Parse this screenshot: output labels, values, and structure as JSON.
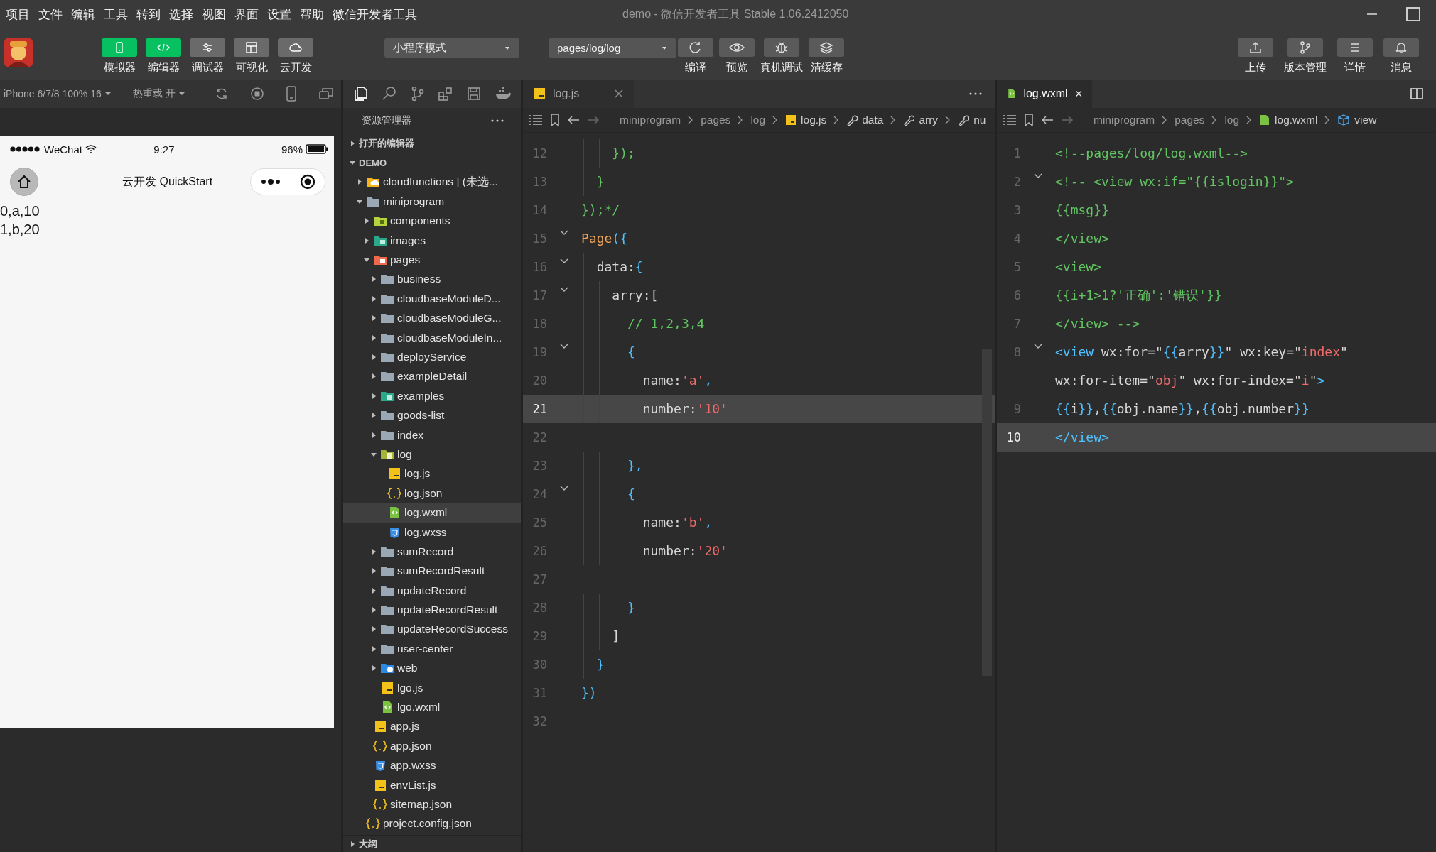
{
  "menu": [
    "项目",
    "文件",
    "编辑",
    "工具",
    "转到",
    "选择",
    "视图",
    "界面",
    "设置",
    "帮助",
    "微信开发者工具"
  ],
  "window": {
    "title": "demo - 微信开发者工具 Stable 1.06.2412050"
  },
  "view_toggles": [
    {
      "label": "模拟器",
      "kind": "phone",
      "on": true
    },
    {
      "label": "编辑器",
      "kind": "code",
      "on": true
    },
    {
      "label": "调试器",
      "kind": "debug",
      "on": false
    },
    {
      "label": "可视化",
      "kind": "layout",
      "on": false
    },
    {
      "label": "云开发",
      "kind": "cloud",
      "on": false
    }
  ],
  "mode_select": {
    "value": "小程序模式"
  },
  "page_select": {
    "value": "pages/log/log"
  },
  "actions": [
    {
      "label": "编译",
      "kind": "refresh"
    },
    {
      "label": "预览",
      "kind": "eye"
    },
    {
      "label": "真机调试",
      "kind": "bug"
    },
    {
      "label": "清缓存",
      "kind": "layers"
    }
  ],
  "right_actions": [
    {
      "label": "上传",
      "kind": "upload"
    },
    {
      "label": "版本管理",
      "kind": "branch"
    },
    {
      "label": "详情",
      "kind": "lines"
    },
    {
      "label": "消息",
      "kind": "bell"
    }
  ],
  "simulator": {
    "device": "iPhone 6/7/8 100% 16",
    "hot_reload": "热重载 开",
    "status": {
      "carrier": "WeChat",
      "time": "9:27",
      "battery": "96%"
    },
    "nav_title": "云开发 QuickStart",
    "lines": [
      "0,a,10",
      "1,b,20"
    ]
  },
  "explorer": {
    "title": "资源管理器",
    "tree": [
      {
        "label": "打开的编辑器",
        "kind": "section",
        "expanded": false,
        "selected": false
      },
      {
        "label": "DEMO",
        "kind": "section",
        "expanded": true,
        "selected": false,
        "children": [
          {
            "label": "cloudfunctions | (未选...",
            "kind": "folder-cloud",
            "expanded": false,
            "selected": false
          },
          {
            "label": "miniprogram",
            "kind": "folder",
            "expanded": true,
            "selected": false,
            "children": [
              {
                "label": "components",
                "kind": "folder-components",
                "expanded": false,
                "selected": false
              },
              {
                "label": "images",
                "kind": "folder-images",
                "expanded": false,
                "selected": false
              },
              {
                "label": "pages",
                "kind": "folder-pages",
                "expanded": true,
                "selected": false,
                "children": [
                  {
                    "label": "business",
                    "kind": "folder",
                    "expanded": false,
                    "selected": false
                  },
                  {
                    "label": "cloudbaseModuleD...",
                    "kind": "folder",
                    "expanded": false,
                    "selected": false
                  },
                  {
                    "label": "cloudbaseModuleG...",
                    "kind": "folder",
                    "expanded": false,
                    "selected": false
                  },
                  {
                    "label": "cloudbaseModuleIn...",
                    "kind": "folder",
                    "expanded": false,
                    "selected": false
                  },
                  {
                    "label": "deployService",
                    "kind": "folder",
                    "expanded": false,
                    "selected": false
                  },
                  {
                    "label": "exampleDetail",
                    "kind": "folder",
                    "expanded": false,
                    "selected": false
                  },
                  {
                    "label": "examples",
                    "kind": "folder-images",
                    "expanded": false,
                    "selected": false
                  },
                  {
                    "label": "goods-list",
                    "kind": "folder",
                    "expanded": false,
                    "selected": false
                  },
                  {
                    "label": "index",
                    "kind": "folder",
                    "expanded": false,
                    "selected": false
                  },
                  {
                    "label": "log",
                    "kind": "folder-log",
                    "expanded": true,
                    "selected": false,
                    "children": [
                      {
                        "label": "log.js",
                        "kind": "js",
                        "selected": false
                      },
                      {
                        "label": "log.json",
                        "kind": "json",
                        "selected": false
                      },
                      {
                        "label": "log.wxml",
                        "kind": "wxml",
                        "selected": true
                      },
                      {
                        "label": "log.wxss",
                        "kind": "wxss",
                        "selected": false
                      }
                    ]
                  },
                  {
                    "label": "sumRecord",
                    "kind": "folder",
                    "expanded": false,
                    "selected": false
                  },
                  {
                    "label": "sumRecordResult",
                    "kind": "folder",
                    "expanded": false,
                    "selected": false
                  },
                  {
                    "label": "updateRecord",
                    "kind": "folder",
                    "expanded": false,
                    "selected": false
                  },
                  {
                    "label": "updateRecordResult",
                    "kind": "folder",
                    "expanded": false,
                    "selected": false
                  },
                  {
                    "label": "updateRecordSuccess",
                    "kind": "folder",
                    "expanded": false,
                    "selected": false
                  },
                  {
                    "label": "user-center",
                    "kind": "folder",
                    "expanded": false,
                    "selected": false
                  },
                  {
                    "label": "web",
                    "kind": "folder-web",
                    "expanded": false,
                    "selected": false
                  },
                  {
                    "label": "lgo.js",
                    "kind": "js",
                    "selected": false
                  },
                  {
                    "label": "lgo.wxml",
                    "kind": "wxml",
                    "selected": false
                  }
                ]
              },
              {
                "label": "app.js",
                "kind": "js",
                "selected": false
              },
              {
                "label": "app.json",
                "kind": "json",
                "selected": false
              },
              {
                "label": "app.wxss",
                "kind": "wxss",
                "selected": false
              },
              {
                "label": "envList.js",
                "kind": "js",
                "selected": false
              },
              {
                "label": "sitemap.json",
                "kind": "json",
                "selected": false
              }
            ]
          },
          {
            "label": "project.config.json",
            "kind": "json",
            "selected": false
          }
        ]
      }
    ],
    "outline": {
      "label": "大纲",
      "expanded": false
    }
  },
  "editors": [
    {
      "tab": {
        "label": "log.js",
        "kind": "js"
      },
      "breadcrumb": [
        {
          "label": "miniprogram",
          "kind": "path"
        },
        {
          "label": "pages",
          "kind": "path"
        },
        {
          "label": "log",
          "kind": "path"
        },
        {
          "label": "log.js",
          "kind": "js"
        },
        {
          "label": "data",
          "kind": "wrench"
        },
        {
          "label": "arry",
          "kind": "wrench"
        },
        {
          "label": "nu",
          "kind": "wrench"
        }
      ],
      "lines": [
        {
          "no": "12",
          "fold": false,
          "current": false,
          "segments": [
            {
              "kind": "comment",
              "text": "    });"
            }
          ]
        },
        {
          "no": "13",
          "fold": false,
          "current": false,
          "segments": [
            {
              "kind": "comment",
              "text": "  }"
            }
          ]
        },
        {
          "no": "14",
          "fold": false,
          "current": false,
          "segments": [
            {
              "kind": "comment",
              "text": "});*/"
            }
          ]
        },
        {
          "no": "15",
          "fold": true,
          "current": false,
          "segments": [
            {
              "kind": "func",
              "text": "Page"
            },
            {
              "kind": "brace",
              "text": "({"
            }
          ]
        },
        {
          "no": "16",
          "fold": true,
          "current": false,
          "segments": [
            {
              "kind": "plain",
              "text": "  data:"
            },
            {
              "kind": "brace",
              "text": "{"
            }
          ]
        },
        {
          "no": "17",
          "fold": true,
          "current": false,
          "segments": [
            {
              "kind": "plain",
              "text": "    arry:["
            }
          ]
        },
        {
          "no": "18",
          "fold": false,
          "current": false,
          "segments": [
            {
              "kind": "comment",
              "text": "      // 1,2,3,4"
            }
          ]
        },
        {
          "no": "19",
          "fold": true,
          "current": false,
          "segments": [
            {
              "kind": "brace",
              "text": "      {"
            }
          ]
        },
        {
          "no": "20",
          "fold": false,
          "current": false,
          "segments": [
            {
              "kind": "plain",
              "text": "        name:"
            },
            {
              "kind": "string",
              "text": "'a'"
            },
            {
              "kind": "brace",
              "text": ","
            }
          ]
        },
        {
          "no": "21",
          "fold": false,
          "current": true,
          "segments": [
            {
              "kind": "plain",
              "text": "        number:"
            },
            {
              "kind": "string",
              "text": "'10'"
            }
          ]
        },
        {
          "no": "22",
          "fold": false,
          "current": false
        },
        {
          "no": "23",
          "fold": false,
          "current": false,
          "segments": [
            {
              "kind": "brace",
              "text": "      },"
            }
          ]
        },
        {
          "no": "24",
          "fold": true,
          "current": false,
          "segments": [
            {
              "kind": "brace",
              "text": "      {"
            }
          ]
        },
        {
          "no": "25",
          "fold": false,
          "current": false,
          "segments": [
            {
              "kind": "plain",
              "text": "        name:"
            },
            {
              "kind": "string",
              "text": "'b'"
            },
            {
              "kind": "brace",
              "text": ","
            }
          ]
        },
        {
          "no": "26",
          "fold": false,
          "current": false,
          "segments": [
            {
              "kind": "plain",
              "text": "        number:"
            },
            {
              "kind": "string",
              "text": "'20'"
            }
          ]
        },
        {
          "no": "27",
          "fold": false,
          "current": false
        },
        {
          "no": "28",
          "fold": false,
          "current": false,
          "segments": [
            {
              "kind": "brace",
              "text": "      }"
            }
          ]
        },
        {
          "no": "29",
          "fold": false,
          "current": false,
          "segments": [
            {
              "kind": "plain",
              "text": "    ]"
            }
          ]
        },
        {
          "no": "30",
          "fold": false,
          "current": false,
          "segments": [
            {
              "kind": "brace",
              "text": "  }"
            }
          ]
        },
        {
          "no": "31",
          "fold": false,
          "current": false,
          "segments": [
            {
              "kind": "brace",
              "text": "})"
            }
          ]
        },
        {
          "no": "32",
          "fold": false,
          "current": false
        }
      ]
    },
    {
      "tab": {
        "label": "log.wxml",
        "kind": "wxml"
      },
      "breadcrumb": [
        {
          "label": "miniprogram",
          "kind": "path"
        },
        {
          "label": "pages",
          "kind": "path"
        },
        {
          "label": "log",
          "kind": "path"
        },
        {
          "label": "log.wxml",
          "kind": "wxml"
        },
        {
          "label": "view",
          "kind": "cube"
        }
      ],
      "lines": [
        {
          "no": "1",
          "fold": false,
          "current": false,
          "segments": [
            {
              "kind": "comment",
              "text": "<!--pages/log/log.wxml-->"
            }
          ]
        },
        {
          "no": "2",
          "fold": true,
          "current": false,
          "segments": [
            {
              "kind": "comment",
              "text": "<!-- <view wx:if=\"{{islogin}}\">"
            }
          ]
        },
        {
          "no": "3",
          "fold": false,
          "current": false,
          "segments": [
            {
              "kind": "comment",
              "text": "{{msg}}"
            }
          ]
        },
        {
          "no": "4",
          "fold": false,
          "current": false,
          "segments": [
            {
              "kind": "comment",
              "text": "</view>"
            }
          ]
        },
        {
          "no": "5",
          "fold": false,
          "current": false,
          "segments": [
            {
              "kind": "comment",
              "text": "<view>"
            }
          ]
        },
        {
          "no": "6",
          "fold": false,
          "current": false,
          "segments": [
            {
              "kind": "comment",
              "text": "{{i+1>1?'正确':'错误'}}"
            }
          ]
        },
        {
          "no": "7",
          "fold": false,
          "current": false,
          "segments": [
            {
              "kind": "comment",
              "text": "</view> -->"
            }
          ]
        },
        {
          "no": "8",
          "fold": true,
          "current": false,
          "segments": [
            {
              "kind": "brace",
              "text": "<view"
            },
            {
              "kind": "plain",
              "text": " wx:for=\""
            },
            {
              "kind": "brace",
              "text": "{{"
            },
            {
              "kind": "plain",
              "text": "arry"
            },
            {
              "kind": "brace",
              "text": "}}"
            },
            {
              "kind": "plain",
              "text": "\" wx:key=\""
            },
            {
              "kind": "string",
              "text": "index"
            },
            {
              "kind": "plain",
              "text": "\""
            }
          ]
        },
        {
          "fold": false,
          "current": false,
          "segments": [
            {
              "kind": "plain",
              "text": "wx:for-item=\""
            },
            {
              "kind": "string",
              "text": "obj"
            },
            {
              "kind": "plain",
              "text": "\" wx:for-index=\""
            },
            {
              "kind": "string",
              "text": "i"
            },
            {
              "kind": "plain",
              "text": "\""
            },
            {
              "kind": "brace",
              "text": ">"
            }
          ]
        },
        {
          "no": "9",
          "fold": false,
          "current": false,
          "segments": [
            {
              "kind": "brace",
              "text": "{{"
            },
            {
              "kind": "plain",
              "text": "i"
            },
            {
              "kind": "brace",
              "text": "}}"
            },
            {
              "kind": "plain",
              "text": ","
            },
            {
              "kind": "brace",
              "text": "{{"
            },
            {
              "kind": "plain",
              "text": "obj.name"
            },
            {
              "kind": "brace",
              "text": "}}"
            },
            {
              "kind": "plain",
              "text": ","
            },
            {
              "kind": "brace",
              "text": "{{"
            },
            {
              "kind": "plain",
              "text": "obj.number"
            },
            {
              "kind": "brace",
              "text": "}}"
            }
          ]
        },
        {
          "no": "10",
          "fold": false,
          "current": true,
          "segments": [
            {
              "kind": "brace",
              "text": "</view>"
            }
          ]
        }
      ]
    }
  ]
}
